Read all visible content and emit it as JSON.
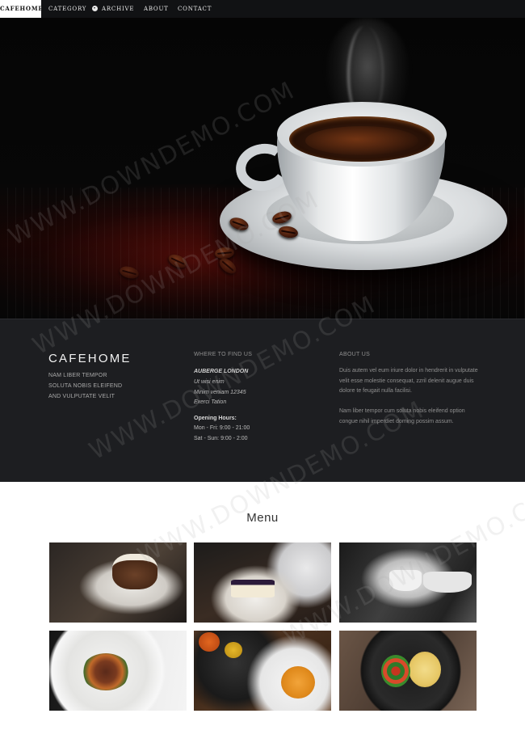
{
  "nav": {
    "items": [
      {
        "label": "CAFEHOME"
      },
      {
        "label": "CATEGORY"
      },
      {
        "label": "ARCHIVE"
      },
      {
        "label": "ABOUT"
      },
      {
        "label": "CONTACT"
      }
    ],
    "dropdown_icon": "chevron-down-circle-icon"
  },
  "info": {
    "brand": "CAFEHOME",
    "tagline": [
      "NAM LIBER TEMPOR",
      "SOLUTA NOBIS ELEIFEND",
      "AND VULPUTATE VELIT"
    ],
    "find_us": {
      "heading": "WHERE TO FIND US",
      "name": "AUBERGE LONDON",
      "address": [
        "Ut wisi enim",
        "Minim veniam 12345",
        "Exerci Tation"
      ],
      "hours_heading": "Opening Hours:",
      "hours": [
        "Mon - Fri: 9:00 - 21:00",
        "Sat - Sun: 9:00 - 2:00"
      ]
    },
    "about": {
      "heading": "ABOUT US",
      "paragraphs": [
        "Duis autem vel eum iriure dolor in hendrerit in vulputate velit esse molestie consequat, zzril delenit augue duis dolore te feugait nulla facilisi.",
        "Nam liber tempor cum soluta nobis eleifend option congue nihil imperdiet doming possim assum."
      ]
    }
  },
  "menu": {
    "title": "Menu",
    "photos": [
      "cake-slice-photo",
      "cheesecake-photo",
      "espresso-machine-photo",
      "meat-plate-photo",
      "soup-table-photo",
      "pasta-pan-photo"
    ]
  },
  "watermark": "WWW.DOWNDEMO.COM",
  "colors": {
    "nav_bg": "#111214",
    "info_bg": "#1d1e21",
    "active_nav_bg": "#ffffff"
  }
}
